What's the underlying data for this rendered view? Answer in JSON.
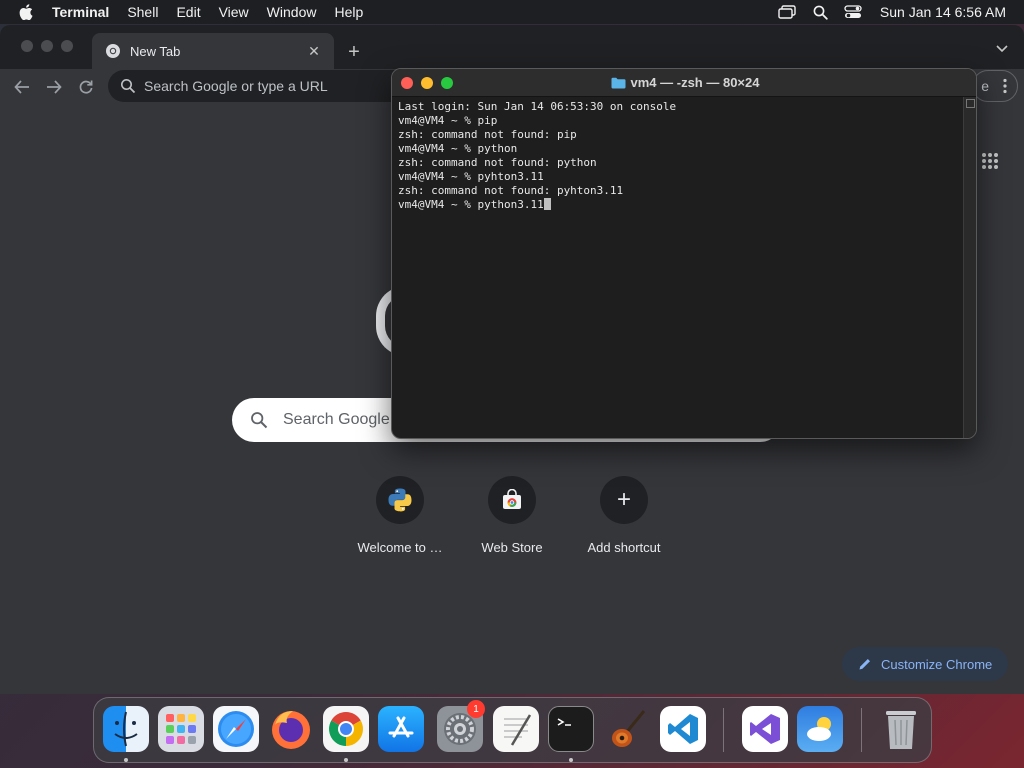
{
  "menubar": {
    "app_name": "Terminal",
    "items": [
      "Shell",
      "Edit",
      "View",
      "Window",
      "Help"
    ],
    "clock": "Sun Jan 14  6:56 AM"
  },
  "chrome": {
    "tab_title": "New Tab",
    "omnibox_placeholder": "Search Google or type a URL",
    "omnibox_tail": "e",
    "search_placeholder": "Search Google",
    "shortcuts": [
      {
        "label": "Welcome to …",
        "icon": "python-icon"
      },
      {
        "label": "Web Store",
        "icon": "web-store-icon"
      },
      {
        "label": "Add shortcut",
        "icon": "plus-icon"
      }
    ],
    "customize_label": "Customize Chrome"
  },
  "terminal": {
    "title": "vm4 — -zsh — 80×24",
    "lines": [
      "Last login: Sun Jan 14 06:53:30 on console",
      "vm4@VM4 ~ % pip",
      "zsh: command not found: pip",
      "vm4@VM4 ~ % python",
      "zsh: command not found: python",
      "vm4@VM4 ~ % pyhton3.11",
      "zsh: command not found: pyhton3.11",
      "vm4@VM4 ~ % python3.11"
    ]
  },
  "dock": {
    "apps": [
      "Finder",
      "Launchpad",
      "Safari",
      "Firefox",
      "Google Chrome",
      "App Store",
      "System Settings",
      "TextEdit",
      "Terminal",
      "GarageBand",
      "Visual Studio Code",
      "Visual Studio",
      "Weather",
      "Trash"
    ],
    "settings_badge": "1"
  },
  "colors": {
    "menubar_bg": "#1e1f22",
    "chrome_bg": "#35363a",
    "terminal_bg": "#1e1e1e",
    "accent_link": "#8ab4f8",
    "close_red": "#fe5f57",
    "minimize_yellow": "#febc2e",
    "zoom_green": "#28c840"
  }
}
